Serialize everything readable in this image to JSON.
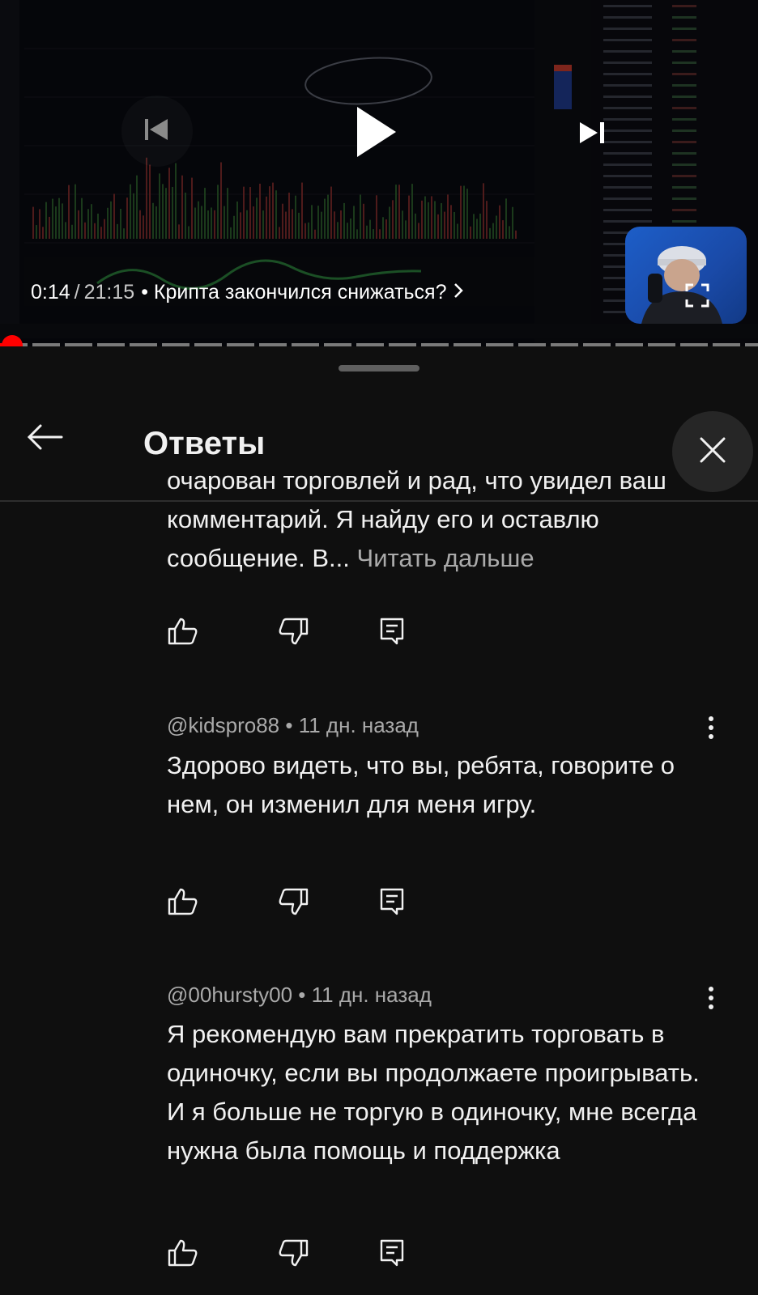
{
  "player": {
    "current_time": "0:14",
    "separator": "/",
    "duration": "21:15",
    "title": "• Крипта закончился снижаться?",
    "progress_fraction": 0.011
  },
  "panel": {
    "title": "Ответы"
  },
  "comments": [
    {
      "text": "очарован торговлей и рад, что увидел ваш комментарий. Я найду его и оставлю сообщение. В...",
      "read_more": "Читать дальше"
    },
    {
      "author": "@kidspro88",
      "time": "• 11 дн. назад",
      "text": "Здорово видеть, что вы, ребята, говорите о нем, он изменил для меня игру."
    },
    {
      "author": "@00hursty00",
      "time": "• 11 дн. назад",
      "text": "Я рекомендую вам прекратить торговать в одиночку, если вы продолжаете проигрывать. И я больше не торгую в одиночку, мне всегда нужна была помощь и поддержка"
    }
  ],
  "icons": {
    "back": "arrow-left-icon",
    "close": "close-icon",
    "like": "thumb-up-icon",
    "dislike": "thumb-down-icon",
    "reply": "reply-icon",
    "more": "more-vert-icon",
    "prev": "skip-previous-icon",
    "play": "play-icon",
    "next": "skip-next-icon",
    "fullscreen": "fullscreen-icon"
  },
  "colors": {
    "background": "#0f0f0f",
    "text": "#f1f1f1",
    "secondary_text": "#aaaaaa",
    "progress": "#ff0000"
  }
}
